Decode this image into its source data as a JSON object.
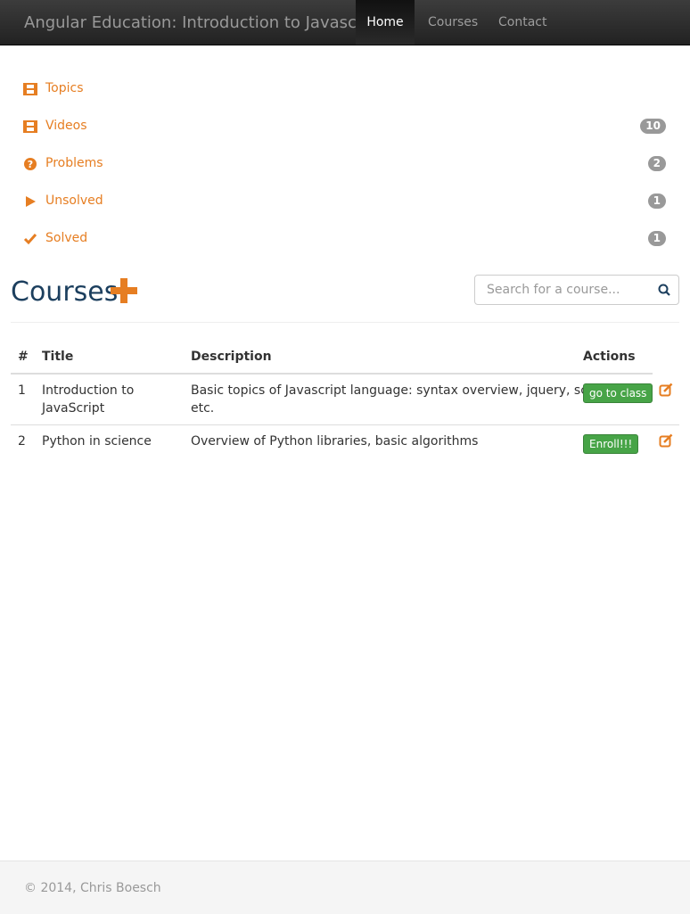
{
  "navbar": {
    "brand": "Angular Education: Introduction to Javascript",
    "items": [
      {
        "label": "Home",
        "active": true
      },
      {
        "label": "Courses",
        "active": false
      },
      {
        "label": "Contact",
        "active": false
      }
    ]
  },
  "sidebar": {
    "items": [
      {
        "label": "Topics",
        "icon": "film-icon",
        "badge": null
      },
      {
        "label": "Videos",
        "icon": "film-icon",
        "badge": "10"
      },
      {
        "label": "Problems",
        "icon": "question-circle-icon",
        "badge": "2"
      },
      {
        "label": "Unsolved",
        "icon": "play-icon",
        "badge": "1"
      },
      {
        "label": "Solved",
        "icon": "check-icon",
        "badge": "1"
      }
    ]
  },
  "courses": {
    "title": "Courses",
    "search_placeholder": "Search for a course...",
    "table": {
      "headers": [
        "#",
        "Title",
        "Description",
        "Actions"
      ],
      "rows": [
        {
          "num": "1",
          "title_line1": "Introduction to",
          "title_line2": "JavaScript",
          "desc_line1": "Basic topics of Javascript language: syntax overview, jquery, scopes",
          "desc_line2": "etc.",
          "action": "go to class"
        },
        {
          "num": "2",
          "title_line1": "Python in science",
          "title_line2": "",
          "desc_line1": "Overview of Python libraries, basic algorithms",
          "desc_line2": "",
          "action": "Enroll!!!"
        }
      ]
    }
  },
  "footer": {
    "text": "© 2014, Chris Boesch"
  },
  "colors": {
    "accent": "#e67e22",
    "title": "#1c3f5e",
    "success": "#47a447",
    "badge": "#999999"
  }
}
